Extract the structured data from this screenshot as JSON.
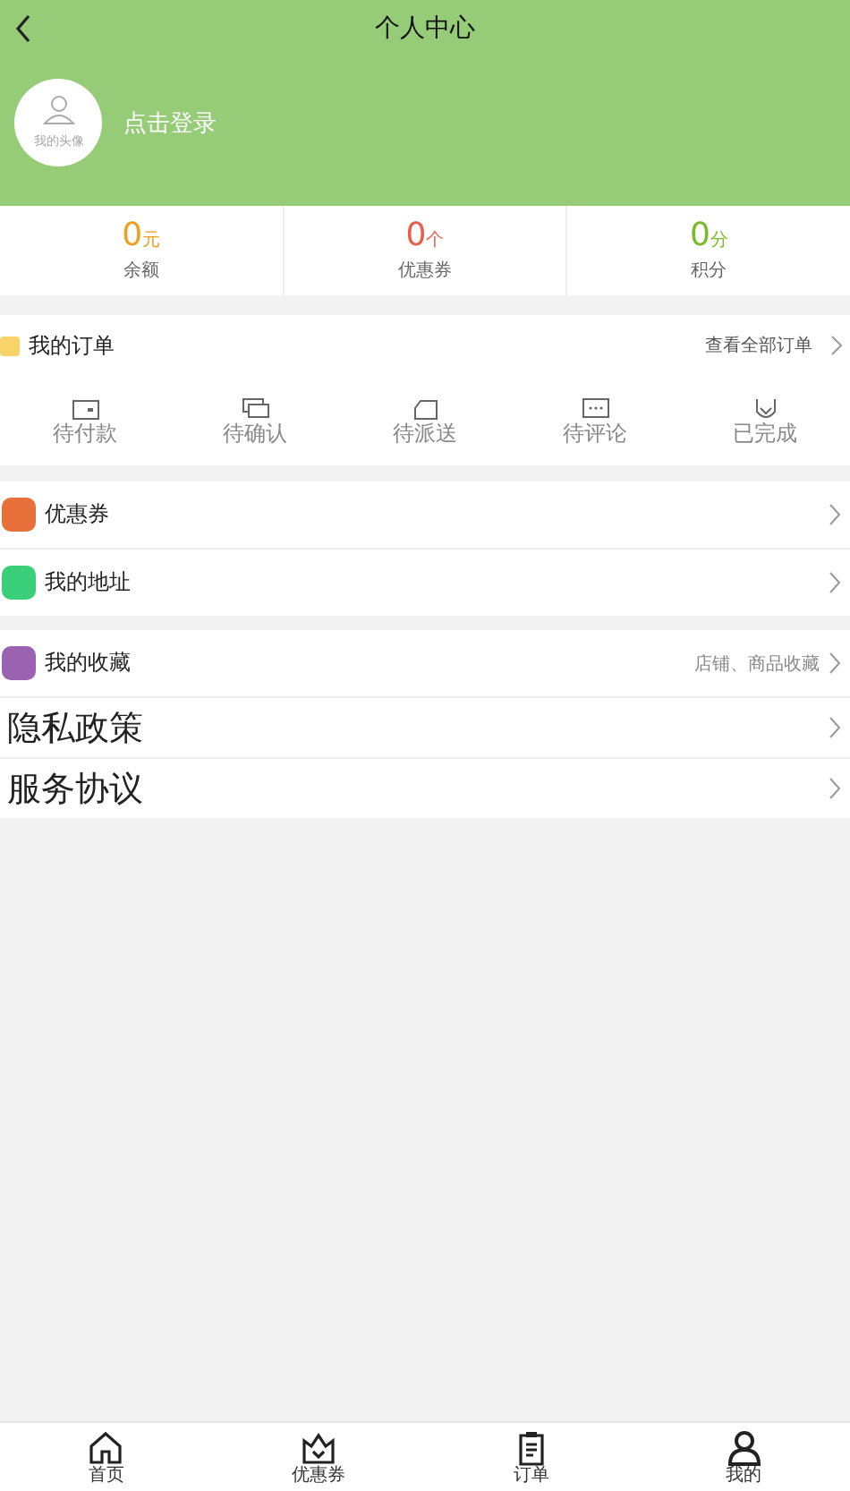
{
  "header": {
    "title": "个人中心",
    "avatar_caption": "我的头像",
    "login_text": "点击登录"
  },
  "stats": [
    {
      "value": "0",
      "unit": "元",
      "label": "余额",
      "color": "#f0a020"
    },
    {
      "value": "0",
      "unit": "个",
      "label": "优惠券",
      "color": "#e8604a"
    },
    {
      "value": "0",
      "unit": "分",
      "label": "积分",
      "color": "#7cba2a"
    }
  ],
  "orders": {
    "title": "我的订单",
    "view_all": "查看全部订单",
    "statuses": [
      {
        "label": "待付款",
        "kind": "wallet"
      },
      {
        "label": "待确认",
        "kind": "chat"
      },
      {
        "label": "待派送",
        "kind": "truck"
      },
      {
        "label": "待评论",
        "kind": "comment"
      },
      {
        "label": "已完成",
        "kind": "done"
      }
    ]
  },
  "menu_groups": [
    [
      {
        "label": "优惠券",
        "kind": "icon",
        "color": "#e8703a"
      },
      {
        "label": "我的地址",
        "kind": "icon",
        "color": "#3ccf7a"
      }
    ],
    [
      {
        "label": "我的收藏",
        "kind": "icon",
        "color": "#9a62b0",
        "hint": "店铺、商品收藏"
      },
      {
        "label": "隐私政策",
        "kind": "plain"
      },
      {
        "label": "服务协议",
        "kind": "plain"
      }
    ]
  ],
  "tab_bar": [
    {
      "label": "首页",
      "kind": "home"
    },
    {
      "label": "优惠券",
      "kind": "coupon"
    },
    {
      "label": "订单",
      "kind": "order"
    },
    {
      "label": "我的",
      "kind": "me"
    }
  ]
}
